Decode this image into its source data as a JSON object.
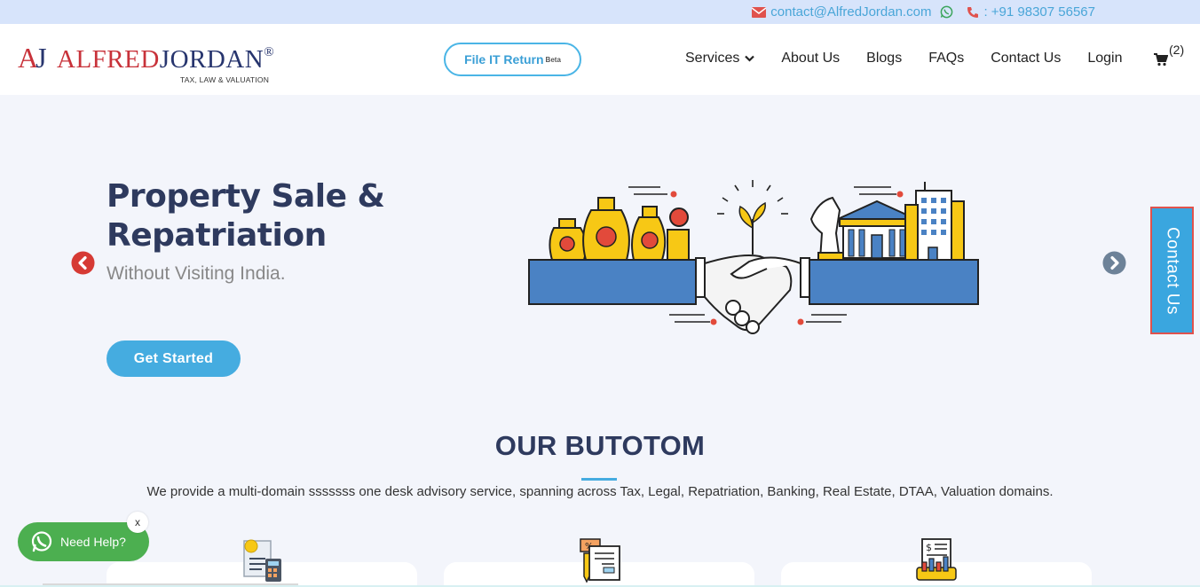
{
  "topbar": {
    "email": "contact@AlfredJordan.com",
    "phone": ": +91 98307 56567",
    "icons": [
      "envelope-icon",
      "whatsapp-icon",
      "phone-icon"
    ]
  },
  "header": {
    "logo": {
      "mark_a": "A",
      "mark_j": "J",
      "word_alfred": "ALFRED",
      "word_jordan": "JORDAN",
      "reg": "®",
      "tagline": "TAX, LAW & VALUATION"
    },
    "file_button": {
      "label": "File IT Return",
      "sup": "Beta"
    },
    "nav": {
      "services": "Services",
      "about": "About Us",
      "blogs": "Blogs",
      "faqs": "FAQs",
      "contact": "Contact Us",
      "login": "Login",
      "cart_count": "(2)"
    }
  },
  "hero": {
    "title": "Property Sale & Repatriation",
    "subtitle": "Without Visiting India.",
    "cta": "Get Started"
  },
  "contact_tab": {
    "label": "Contact Us"
  },
  "section": {
    "title": "OUR BUTOTOM",
    "description": "We provide a multi-domain sssssss one desk advisory service, spanning across Tax, Legal, Repatriation, Banking, Real Estate, DTAA, Valuation domains."
  },
  "chat": {
    "label": "Need Help?",
    "close": "x"
  },
  "colors": {
    "accent": "#45ace0",
    "heading": "#2e3a5e",
    "brand_red": "#c8323a",
    "brand_navy": "#27356e",
    "whatsapp": "#4caf50"
  }
}
